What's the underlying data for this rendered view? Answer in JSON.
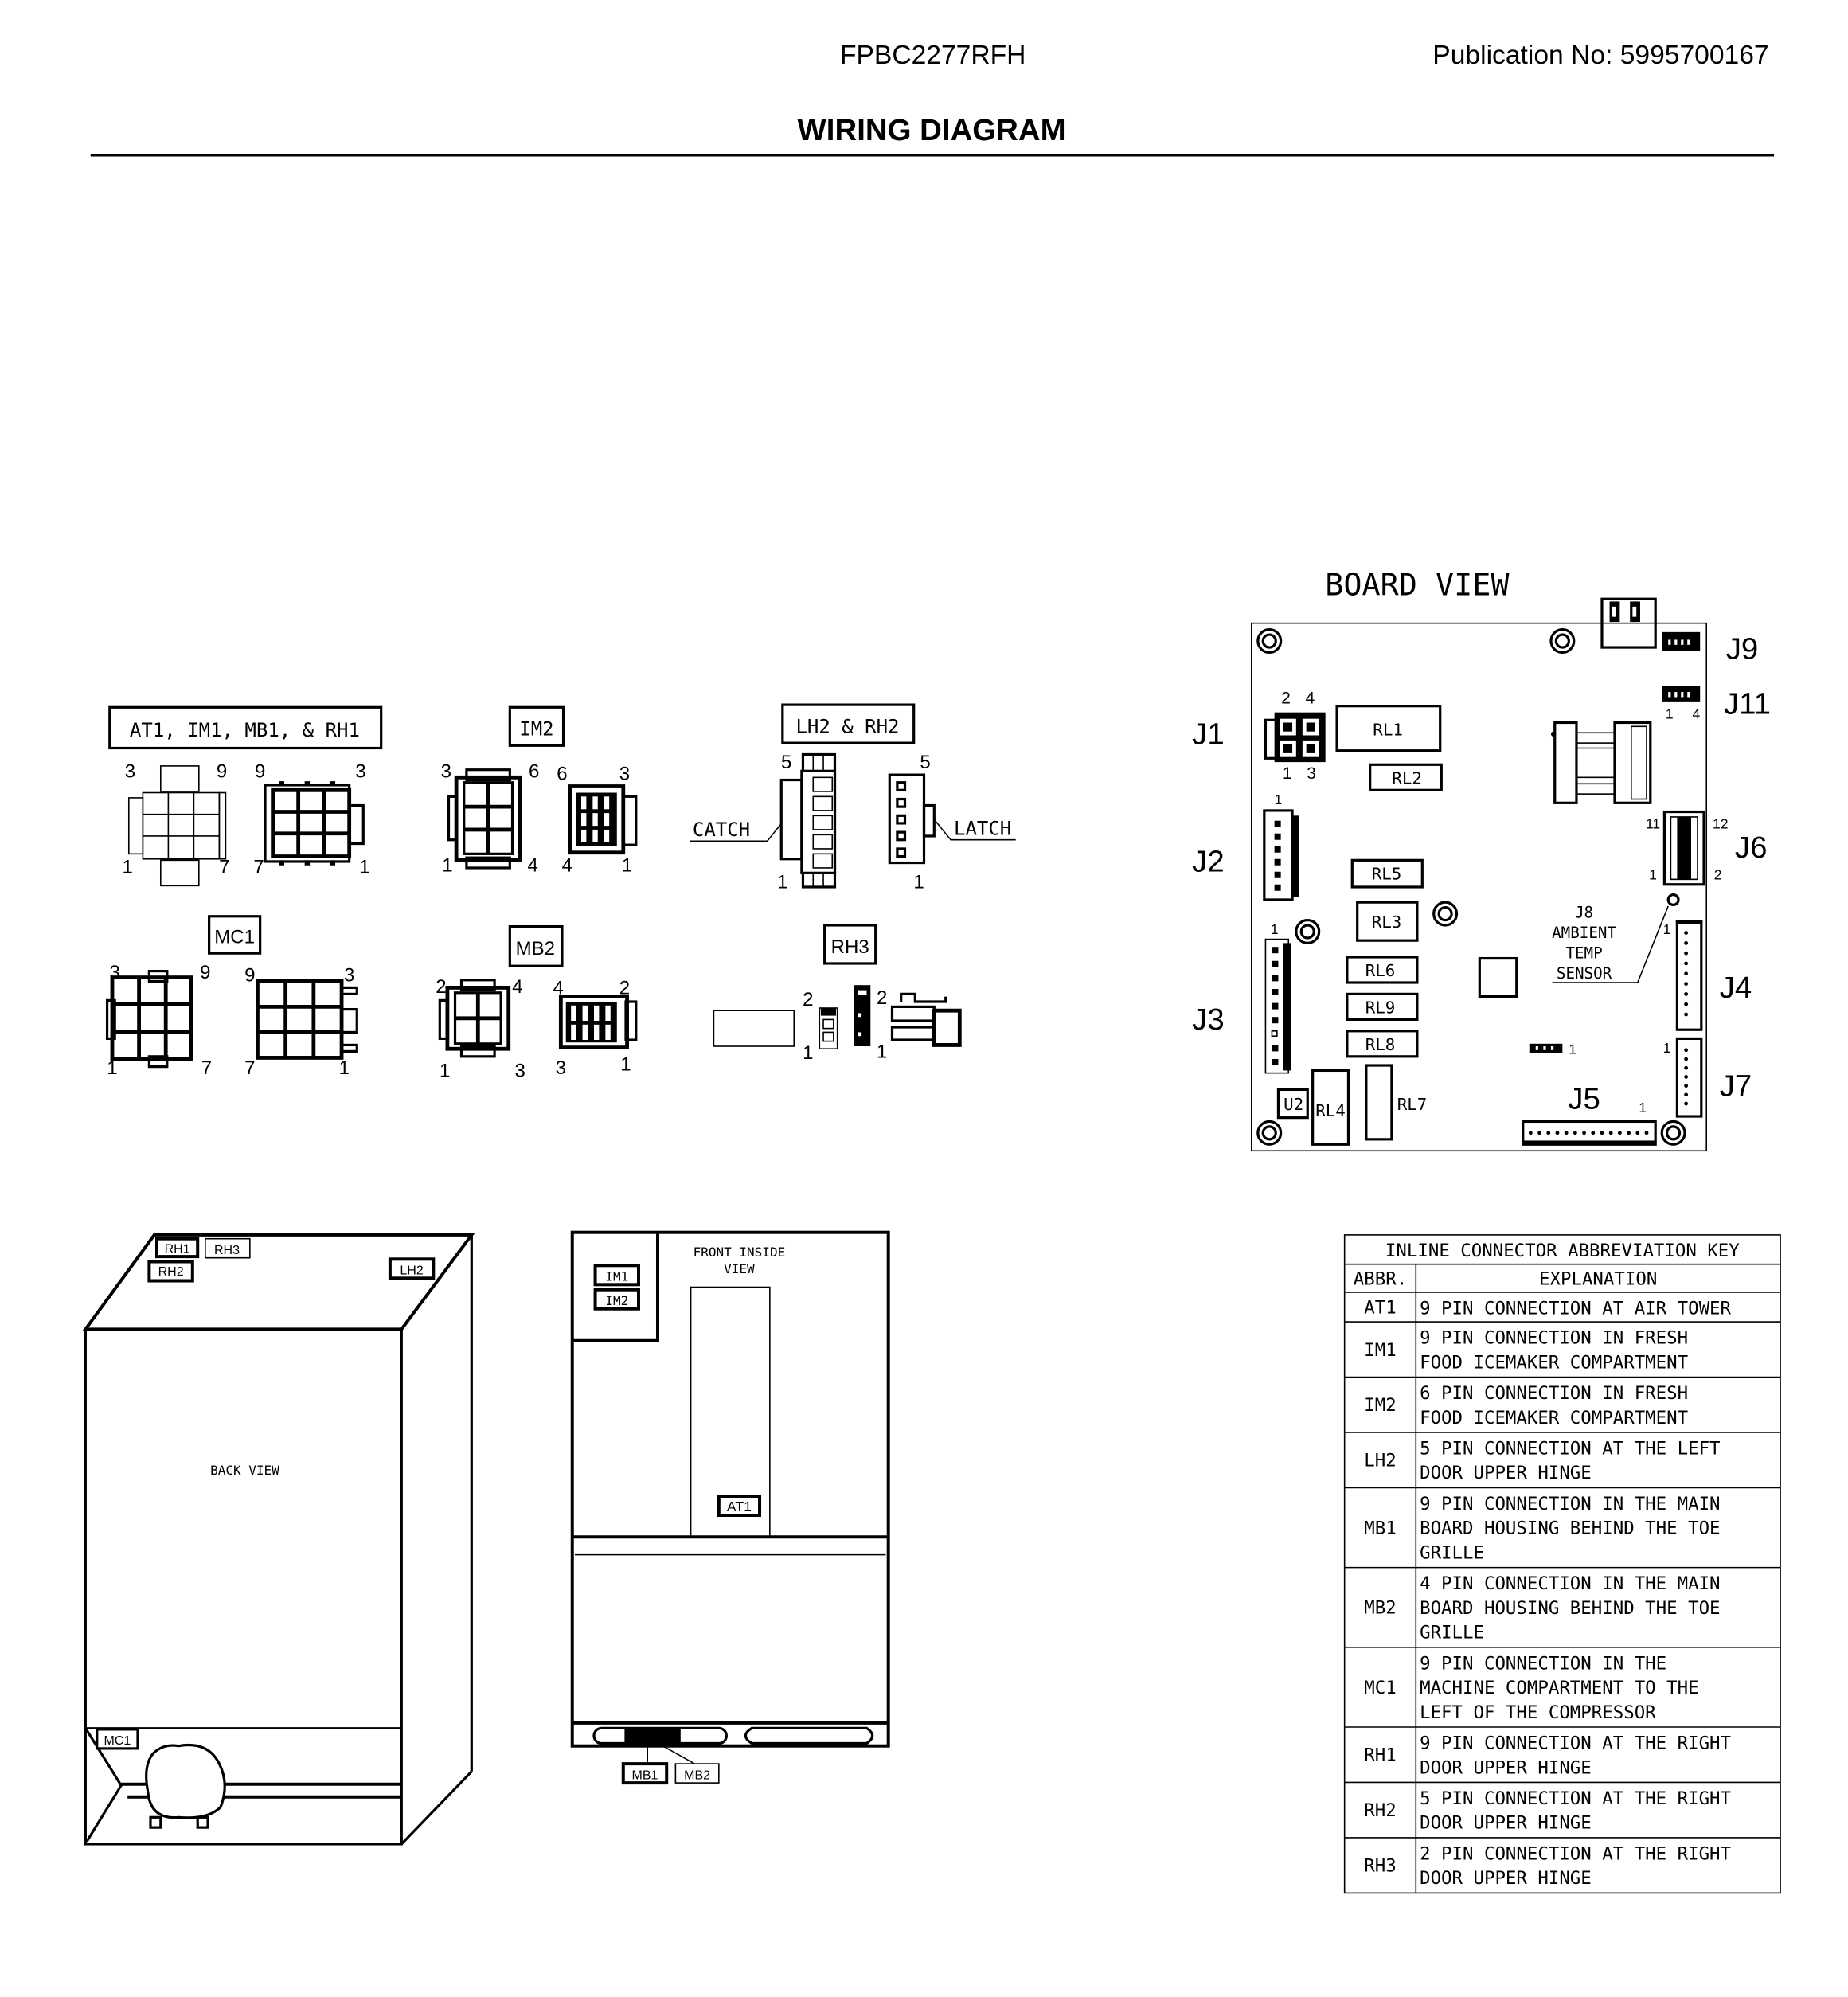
{
  "header": {
    "model": "FPBC2277RFH",
    "publication": "Publication No:  5995700167",
    "title": "WIRING DIAGRAM"
  },
  "connectors": {
    "at1_group": {
      "label": "AT1, IM1, MB1, & RH1",
      "pins_left": [
        "3",
        "9",
        "1",
        "7"
      ],
      "pins_right": [
        "9",
        "3",
        "7",
        "1"
      ]
    },
    "im2": {
      "label": "IM2",
      "pins_left": [
        "3",
        "6",
        "1",
        "4"
      ],
      "pins_right": [
        "6",
        "3",
        "4",
        "1"
      ]
    },
    "lh2_rh2": {
      "label": "LH2 & RH2",
      "catch_label": "CATCH",
      "latch_label": "LATCH",
      "pins_left": [
        "5",
        "1"
      ],
      "pins_right": [
        "5",
        "1"
      ]
    },
    "mc1": {
      "label": "MC1",
      "pins_left": [
        "3",
        "9",
        "1",
        "7"
      ],
      "pins_right": [
        "9",
        "3",
        "7",
        "1"
      ]
    },
    "mb2": {
      "label": "MB2",
      "pins_left": [
        "2",
        "4",
        "1",
        "3"
      ],
      "pins_right": [
        "4",
        "2",
        "3",
        "1"
      ]
    },
    "rh3": {
      "label": "RH3",
      "pins_a": [
        "2",
        "1"
      ],
      "pins_b": [
        "2",
        "1"
      ]
    }
  },
  "board": {
    "title": "BOARD VIEW",
    "jacks": {
      "j1": "J1",
      "j2": "J2",
      "j3": "J3",
      "j4": "J4",
      "j5": "J5",
      "j6": "J6",
      "j7": "J7",
      "j9": "J9",
      "j11": "J11"
    },
    "j1_pins": [
      "2",
      "4",
      "1",
      "3"
    ],
    "j11_pins": [
      "1",
      "4"
    ],
    "j6_pins": [
      "11",
      "12",
      "1",
      "2"
    ],
    "pin_one": "1",
    "relays": [
      "RL1",
      "RL2",
      "RL5",
      "RL3",
      "RL6",
      "RL9",
      "RL8",
      "RL4",
      "RL7"
    ],
    "u2": "U2",
    "j8_label": [
      "J8",
      "AMBIENT",
      "TEMP",
      "SENSOR"
    ]
  },
  "back_view": {
    "label": "BACK VIEW",
    "tags": {
      "rh1": "RH1",
      "rh3": "RH3",
      "rh2": "RH2",
      "lh2": "LH2",
      "mc1": "MC1"
    }
  },
  "front_view": {
    "label": [
      "FRONT INSIDE",
      "VIEW"
    ],
    "tags": {
      "im1": "IM1",
      "im2": "IM2",
      "at1": "AT1",
      "mb1": "MB1",
      "mb2": "MB2"
    }
  },
  "key_table": {
    "title": "INLINE CONNECTOR ABBREVIATION KEY",
    "headers": [
      "ABBR.",
      "EXPLANATION"
    ],
    "rows": [
      {
        "abbr": "AT1",
        "lines": [
          "9 PIN CONNECTION AT AIR TOWER"
        ]
      },
      {
        "abbr": "IM1",
        "lines": [
          "9 PIN CONNECTION IN FRESH",
          "FOOD ICEMAKER COMPARTMENT"
        ]
      },
      {
        "abbr": "IM2",
        "lines": [
          "6 PIN CONNECTION IN FRESH",
          "FOOD ICEMAKER COMPARTMENT"
        ]
      },
      {
        "abbr": "LH2",
        "lines": [
          "5 PIN CONNECTION AT THE LEFT",
          "DOOR UPPER HINGE"
        ]
      },
      {
        "abbr": "MB1",
        "lines": [
          "9 PIN CONNECTION IN THE MAIN",
          "BOARD HOUSING BEHIND THE TOE",
          "GRILLE"
        ]
      },
      {
        "abbr": "MB2",
        "lines": [
          "4 PIN CONNECTION IN THE MAIN",
          "BOARD HOUSING BEHIND THE TOE",
          "GRILLE"
        ]
      },
      {
        "abbr": "MC1",
        "lines": [
          "9 PIN CONNECTION IN THE",
          "MACHINE COMPARTMENT TO THE",
          "LEFT OF THE COMPRESSOR"
        ]
      },
      {
        "abbr": "RH1",
        "lines": [
          "9 PIN CONNECTION AT THE RIGHT",
          "DOOR UPPER HINGE"
        ]
      },
      {
        "abbr": "RH2",
        "lines": [
          "5 PIN CONNECTION AT THE RIGHT",
          "DOOR UPPER HINGE"
        ]
      },
      {
        "abbr": "RH3",
        "lines": [
          "2 PIN CONNECTION AT THE RIGHT",
          "DOOR UPPER HINGE"
        ]
      }
    ]
  }
}
